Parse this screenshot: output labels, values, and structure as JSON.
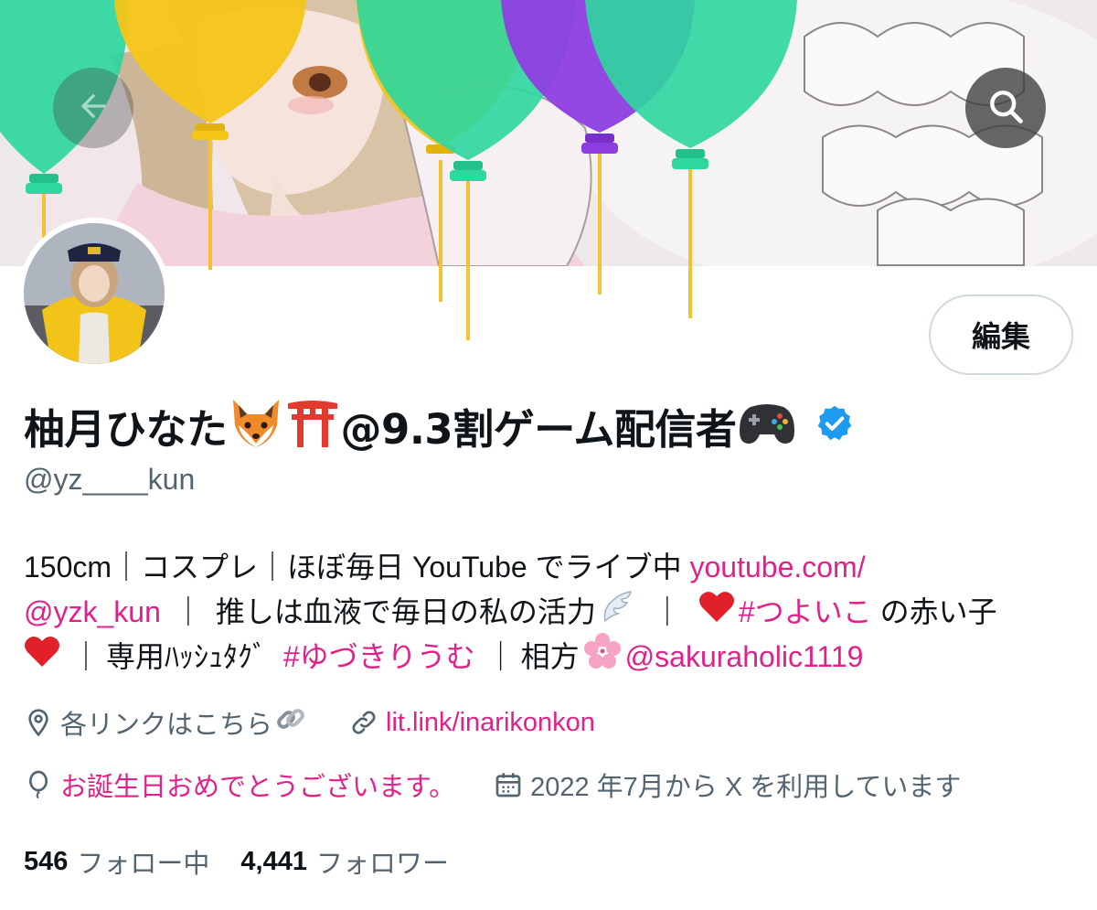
{
  "profile": {
    "display_name": "柚月ひなた",
    "display_name_suffix": "@9.3割ゲーム配信者",
    "handle": "@yz____kun",
    "edit_label": "編集",
    "bio": {
      "line1_text": "150cm｜コスプレ｜ほぼ毎日 YouTube でライブ中",
      "line1_link": "youtube.com/",
      "line2_link": "@yzk_kun",
      "line2_text": "推しは血液で毎日の私の活力",
      "line2_hashtag": "#つよいこ",
      "line2_tail": "の赤い子",
      "line3_text": "専用ﾊｯｼｭﾀｸﾞ",
      "line3_hashtag": "#ゆづきりうむ",
      "line3_partner_label": "相方",
      "line3_mention": "@sakuraholic1119"
    },
    "location": "各リンクはこちら",
    "website": "lit.link/inarikonkon",
    "birthday": "お誕生日おめでとうございます。",
    "joined": "2022 年7月から X を利用しています",
    "following_count": "546",
    "following_label": "フォロー中",
    "followers_count": "4,441",
    "followers_label": "フォロワー"
  },
  "icons": {
    "back": "back-arrow-icon",
    "search": "search-icon",
    "verified": "verified-badge-icon",
    "location": "location-pin-icon",
    "link": "link-icon",
    "birthday": "balloon-icon",
    "calendar": "calendar-icon"
  },
  "colors": {
    "accent_link": "#e0218a",
    "secondary_text": "#536471",
    "verified_blue": "#1d9bf0",
    "balloon_green": "#2ed6a0",
    "balloon_yellow": "#f5c518",
    "balloon_purple": "#8e3ee0"
  }
}
